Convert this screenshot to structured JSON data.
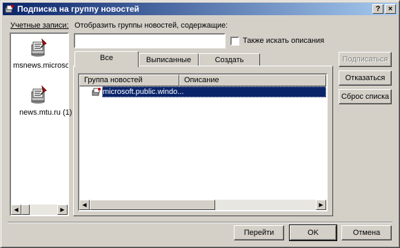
{
  "window": {
    "title": "Подписка на группу новостей",
    "help_btn": "?",
    "close_btn": "×"
  },
  "accounts": {
    "label": "Учетные записи:",
    "items": [
      {
        "label": "msnews.microsoft.",
        "selected": true,
        "icon": "news-server-icon"
      },
      {
        "label": "news.mtu.ru (1)",
        "selected": false,
        "icon": "news-server-icon"
      }
    ]
  },
  "filter": {
    "label": "Отобразить группы новостей, содержащие:",
    "value": "",
    "desc_checkbox_label": "Также искать описания",
    "desc_checked": false
  },
  "tabs": [
    {
      "label": "Все",
      "active": true
    },
    {
      "label": "Выписанные",
      "active": false
    },
    {
      "label": "Создать",
      "active": false
    }
  ],
  "list": {
    "columns": [
      "Группа новостей",
      "Описание"
    ],
    "rows": [
      {
        "name": "microsoft.public.windo...",
        "description": "",
        "selected": true
      }
    ]
  },
  "side_buttons": {
    "subscribe": "Подписаться",
    "unsubscribe": "Отказаться",
    "reset": "Сброс списка"
  },
  "bottom_buttons": {
    "goto": "Перейти",
    "ok": "OK",
    "cancel": "Отмена"
  },
  "colors": {
    "selection": "#0a246a",
    "face": "#d4d0c8"
  }
}
